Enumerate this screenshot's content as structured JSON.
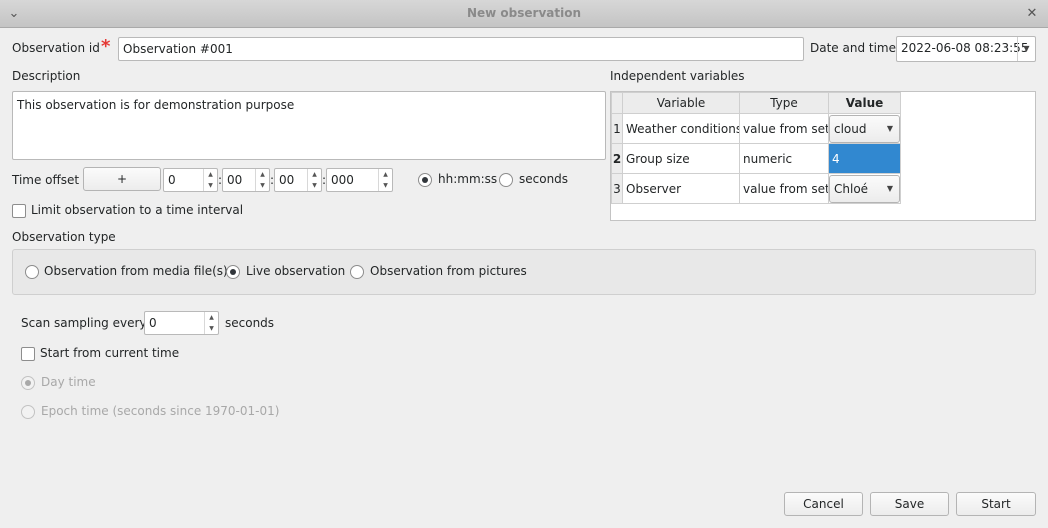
{
  "window": {
    "title": "New observation"
  },
  "observation_id": {
    "label": "Observation id",
    "required_mark": "*",
    "value": "Observation #001"
  },
  "date_time": {
    "label": "Date and time",
    "value": "2022-06-08 08:23:55"
  },
  "description": {
    "label": "Description",
    "value": "This observation is for demonstration purpose"
  },
  "time_offset": {
    "label": "Time offset",
    "sign_button": "+",
    "hours": "0",
    "minutes": "00",
    "seconds": "00",
    "milliseconds": "000",
    "sep": ":",
    "format_hhmmss": "hh:mm:ss",
    "format_seconds": "seconds"
  },
  "limit_interval": {
    "label": "Limit observation to a time interval"
  },
  "independent_variables": {
    "title": "Independent variables",
    "columns": [
      "Variable",
      "Type",
      "Value"
    ],
    "rows": [
      {
        "num": "1",
        "variable": "Weather conditions",
        "type": "value from set",
        "value": "cloud"
      },
      {
        "num": "2",
        "variable": "Group size",
        "type": "numeric",
        "value": "4"
      },
      {
        "num": "3",
        "variable": "Observer",
        "type": "value from set",
        "value": "Chloé"
      }
    ]
  },
  "observation_type": {
    "label": "Observation type",
    "options": [
      "Observation from media file(s)",
      "Live observation",
      "Observation from pictures"
    ],
    "selected": "Live observation"
  },
  "scan_sampling": {
    "label": "Scan sampling every",
    "value": "0",
    "unit": "seconds"
  },
  "start_current_time": {
    "label": "Start from current time"
  },
  "time_format": {
    "day_time": "Day time",
    "epoch_time": "Epoch time (seconds since 1970-01-01)"
  },
  "buttons": {
    "cancel": "Cancel",
    "save": "Save",
    "start": "Start"
  }
}
